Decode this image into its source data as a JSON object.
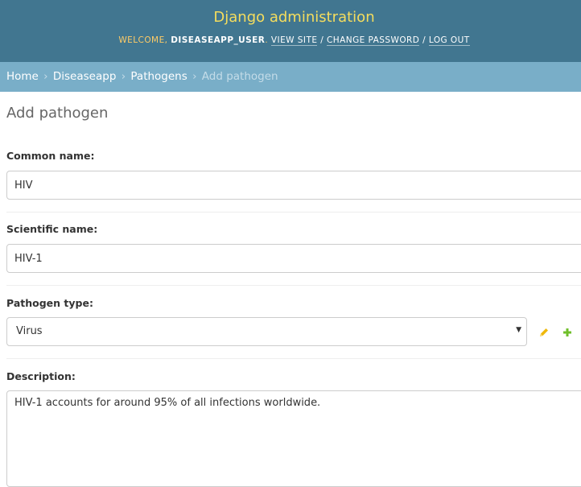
{
  "header": {
    "site_name": "Django administration",
    "welcome": "Welcome,",
    "username": "DISEASEAPP_USER",
    "view_site": "View site",
    "change_password": "Change password",
    "log_out": "Log out",
    "separator": "/"
  },
  "breadcrumbs": {
    "home": "Home",
    "app": "Diseaseapp",
    "model": "Pathogens",
    "current": "Add pathogen",
    "separator": "›"
  },
  "page_title": "Add pathogen",
  "form": {
    "common_name": {
      "label": "Common name:",
      "value": "HIV"
    },
    "scientific_name": {
      "label": "Scientific name:",
      "value": "HIV-1"
    },
    "pathogen_type": {
      "label": "Pathogen type:",
      "selected": "Virus"
    },
    "description": {
      "label": "Description:",
      "value": "HIV-1 accounts for around 95% of all infections worldwide."
    }
  },
  "icons": {
    "edit": "pencil-icon",
    "add": "plus-icon",
    "dropdown": "chevron-down-icon"
  },
  "colors": {
    "header_bg": "#417690",
    "site_name": "#f5dd5d",
    "breadcrumbs_bg": "#79aec8",
    "edit_icon": "#efb80b",
    "add_icon": "#70bf2b"
  }
}
